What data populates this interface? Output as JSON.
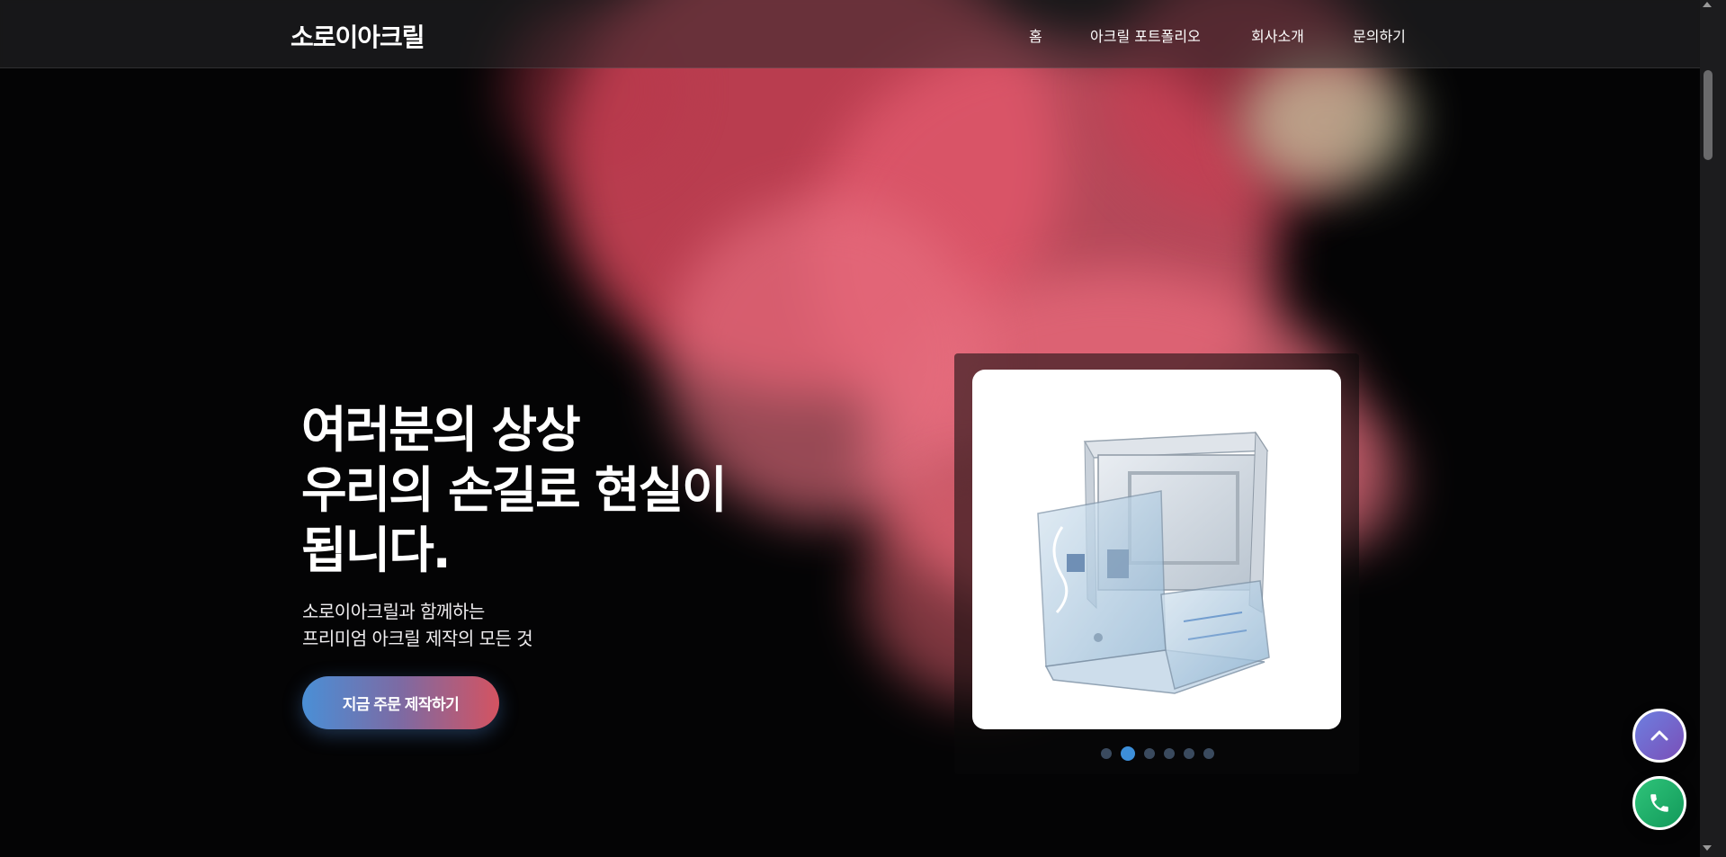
{
  "brand": {
    "name": "소로이아크릴"
  },
  "nav": {
    "items": [
      {
        "label": "홈"
      },
      {
        "label": "아크릴 포트폴리오"
      },
      {
        "label": "회사소개"
      },
      {
        "label": "문의하기"
      }
    ]
  },
  "hero": {
    "title_lines": [
      "여러분의 상상",
      "우리의 손길로 현실이",
      "됩니다."
    ],
    "subtitle_lines": [
      "소로이아크릴과 함께하는",
      "프리미엄 아크릴 제작의 모든 것"
    ],
    "cta_label": "지금 주문 제작하기"
  },
  "slider": {
    "total_slides": 6,
    "active_index": 1,
    "image_subject": "clear acrylic enclosure box"
  },
  "floating": {
    "top_icon": "chevron-up-icon",
    "call_icon": "phone-icon"
  },
  "colors": {
    "accent_blue": "#3d8fd9",
    "cta_gradient_start": "#4a8fd6",
    "cta_gradient_end": "#d45361",
    "smoke_pink": "#e65a6c",
    "call_green": "#1fae68",
    "top_purple": "#7366d0"
  }
}
